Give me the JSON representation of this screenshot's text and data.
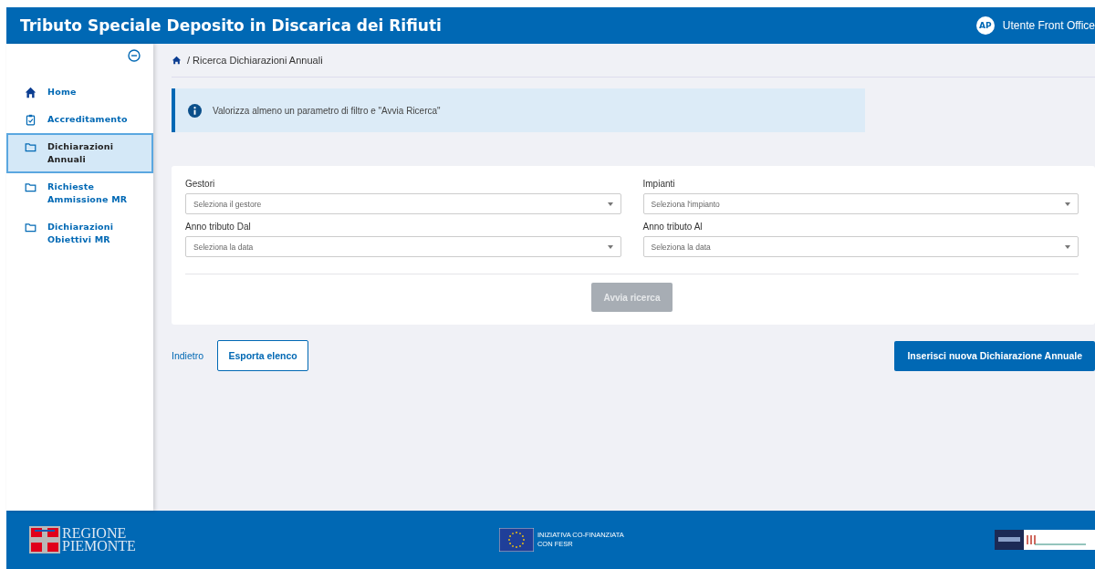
{
  "header": {
    "title": "Tributo Speciale Deposito in Discarica dei Rifiuti",
    "user_initials": "AP",
    "user_name": "Utente Front Office"
  },
  "sidebar": {
    "items": [
      {
        "label": "Home",
        "kind": "home",
        "selected": false
      },
      {
        "label": "Accreditamento",
        "kind": "clipboard",
        "selected": false
      },
      {
        "label": "Dichiarazioni Annuali",
        "kind": "folder",
        "selected": true
      },
      {
        "label": "Richieste Ammissione MR",
        "kind": "folder",
        "selected": false
      },
      {
        "label": "Dichiarazioni Obiettivi MR",
        "kind": "folder",
        "selected": false
      }
    ]
  },
  "breadcrumb": "/ Ricerca Dichiarazioni Annuali",
  "info_message": "Valorizza almeno un parametro di filtro e \"Avvia Ricerca\"",
  "filters": [
    {
      "label": "Gestori",
      "placeholder": "Seleziona il gestore"
    },
    {
      "label": "Impianti",
      "placeholder": "Seleziona l'impianto"
    },
    {
      "label": "Anno tributo Dal",
      "placeholder": "Seleziona la data"
    },
    {
      "label": "Anno tributo Al",
      "placeholder": "Seleziona la data"
    }
  ],
  "search_button": {
    "label": "Avvia ricerca",
    "disabled": true
  },
  "actions": {
    "back": "Indietro",
    "export": "Esporta elenco",
    "new": "Inserisci nuova Dichiarazione Annuale"
  },
  "footer": {
    "region_line1": "REGIONE",
    "region_line2": "PIEMONTE",
    "eu_line1": "INIZIATIVA CO-FINANZIATA",
    "eu_line2": "CON FESR"
  }
}
